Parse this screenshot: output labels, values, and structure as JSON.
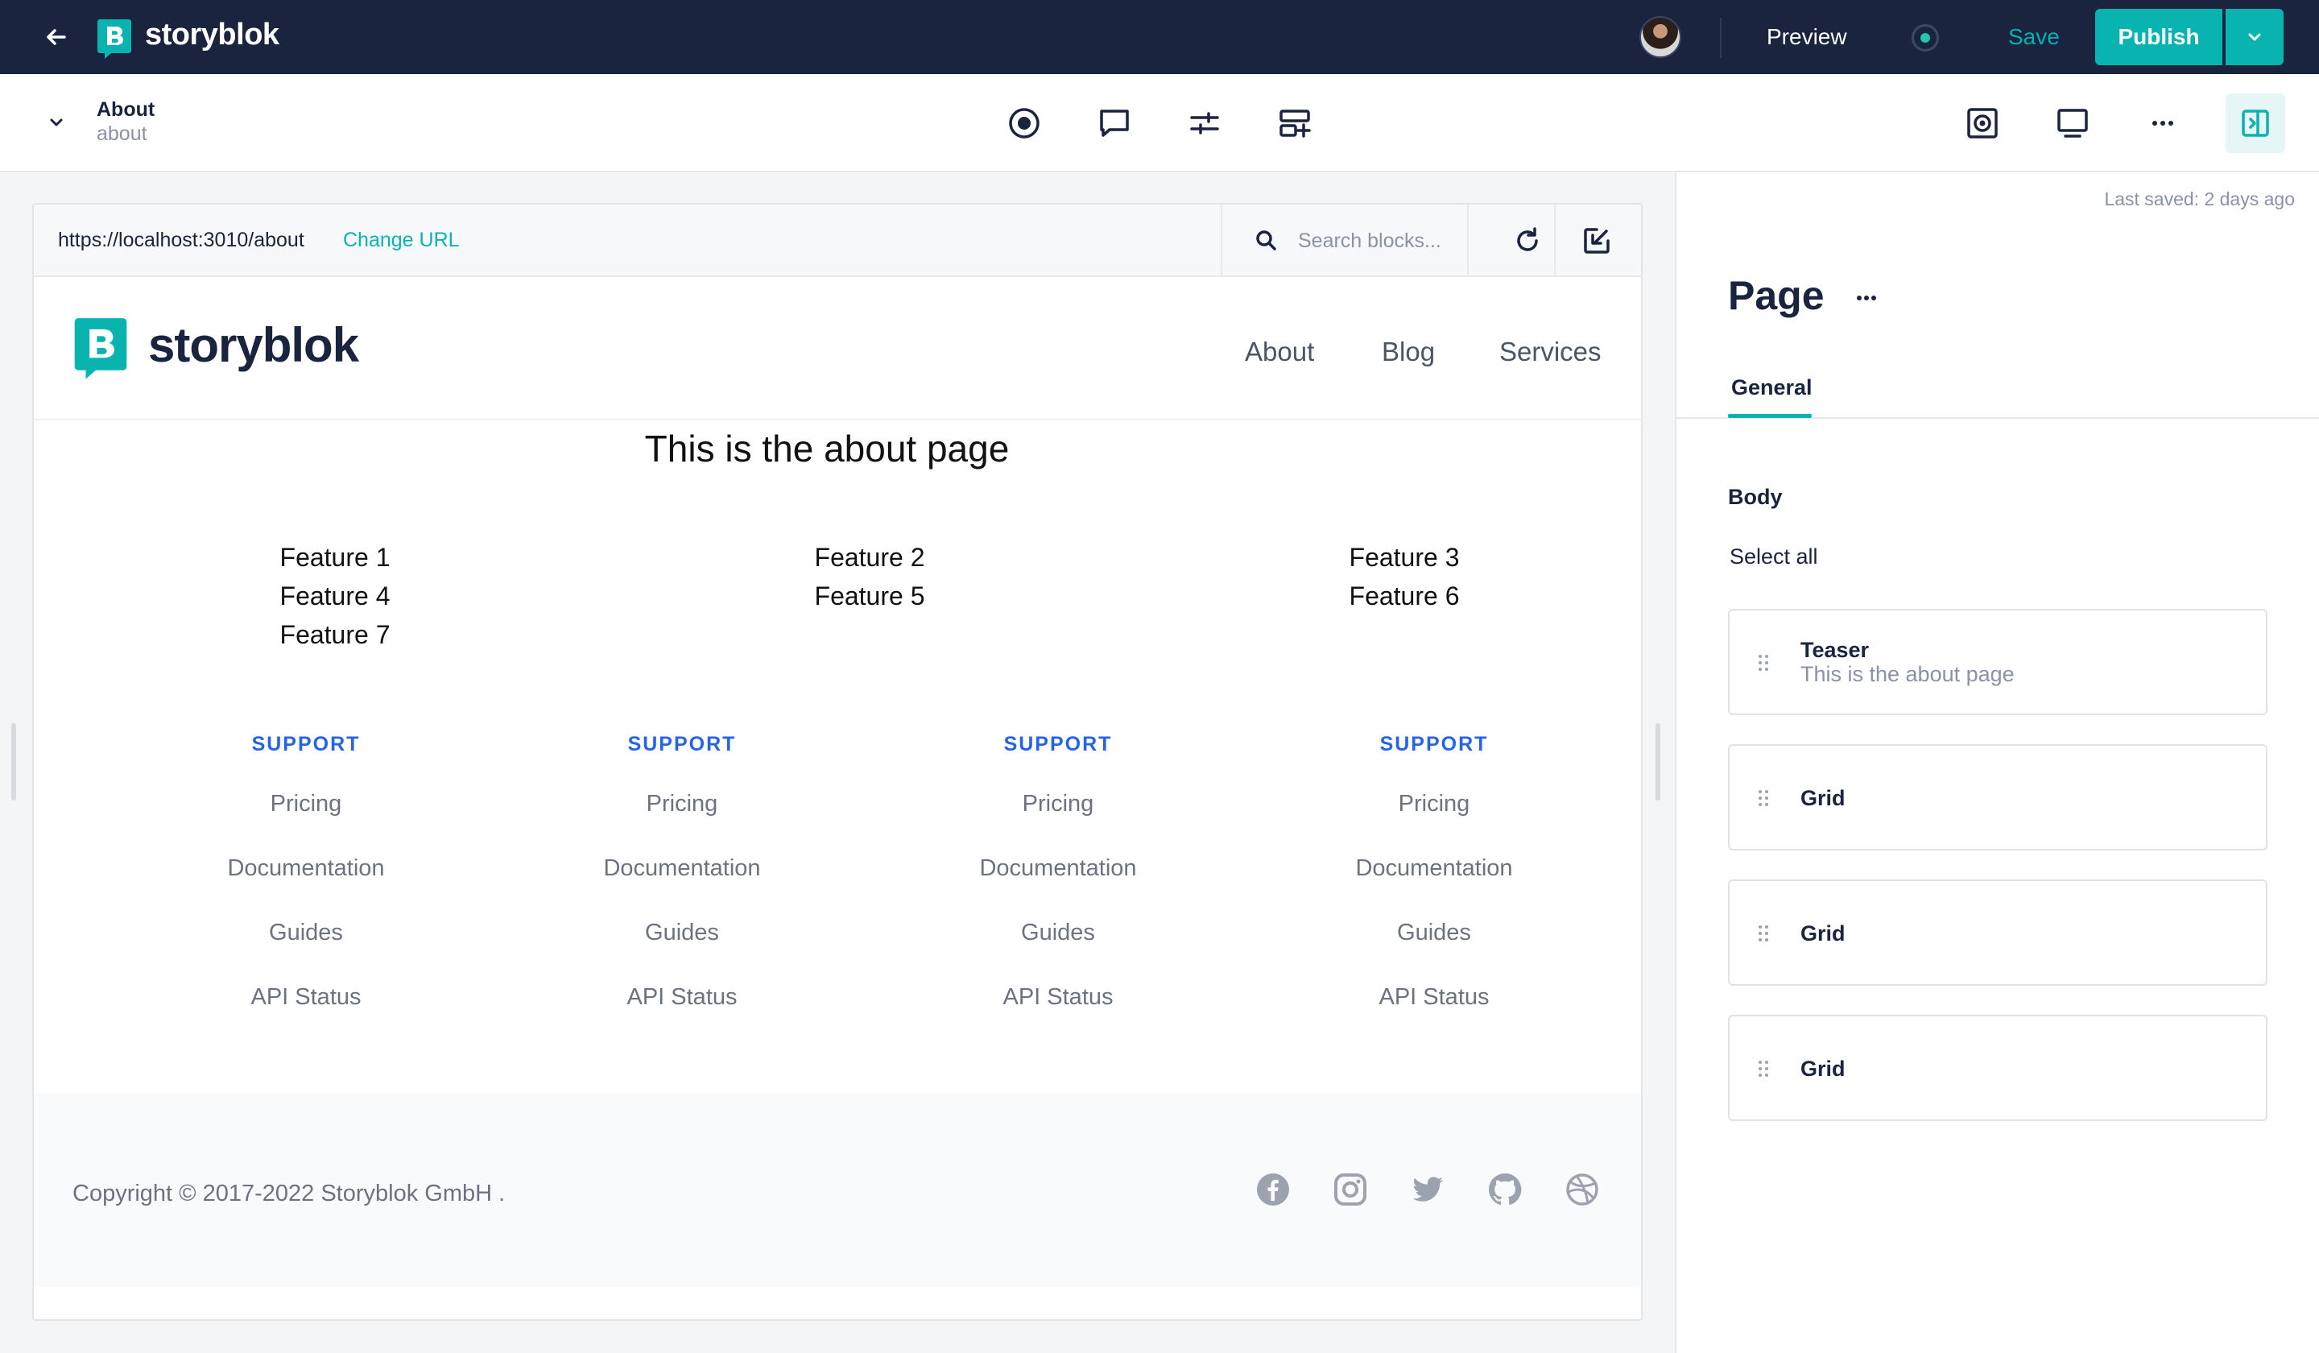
{
  "topbar": {
    "brand": "storyblok",
    "preview_label": "Preview",
    "save_label": "Save",
    "publish_label": "Publish",
    "accent": "#09b3af",
    "bg": "#1b243f"
  },
  "story": {
    "title": "About",
    "slug": "about"
  },
  "toolbar": {
    "icons": [
      "target-icon",
      "comment-icon",
      "sliders-icon",
      "add-block-icon",
      "screenshot-icon",
      "desktop-icon",
      "more-icon",
      "panel-toggle-icon"
    ]
  },
  "preview": {
    "url": "https://localhost:3010/about",
    "change_url_label": "Change URL",
    "search_placeholder": "Search blocks...",
    "site": {
      "brand": "storyblok",
      "nav": [
        "About",
        "Blog",
        "Services"
      ],
      "heading": "This is the about page",
      "features": [
        "Feature 1",
        "Feature 2",
        "Feature 3",
        "Feature 4",
        "Feature 5",
        "Feature 6",
        "Feature 7"
      ],
      "footer_columns": [
        {
          "title": "SUPPORT",
          "links": [
            "Pricing",
            "Documentation",
            "Guides",
            "API Status"
          ]
        },
        {
          "title": "SUPPORT",
          "links": [
            "Pricing",
            "Documentation",
            "Guides",
            "API Status"
          ]
        },
        {
          "title": "SUPPORT",
          "links": [
            "Pricing",
            "Documentation",
            "Guides",
            "API Status"
          ]
        },
        {
          "title": "SUPPORT",
          "links": [
            "Pricing",
            "Documentation",
            "Guides",
            "API Status"
          ]
        }
      ],
      "copyright": "Copyright © 2017-2022  Storyblok GmbH  .",
      "social_icons": [
        "facebook-icon",
        "instagram-icon",
        "twitter-icon",
        "github-icon",
        "dribbble-icon"
      ]
    }
  },
  "panel": {
    "last_saved": "Last saved: 2 days ago",
    "title": "Page",
    "tab": "General",
    "body_label": "Body",
    "select_all": "Select all",
    "blocks": [
      {
        "name": "Teaser",
        "sub": "This is the about page"
      },
      {
        "name": "Grid",
        "sub": ""
      },
      {
        "name": "Grid",
        "sub": ""
      },
      {
        "name": "Grid",
        "sub": ""
      }
    ]
  }
}
